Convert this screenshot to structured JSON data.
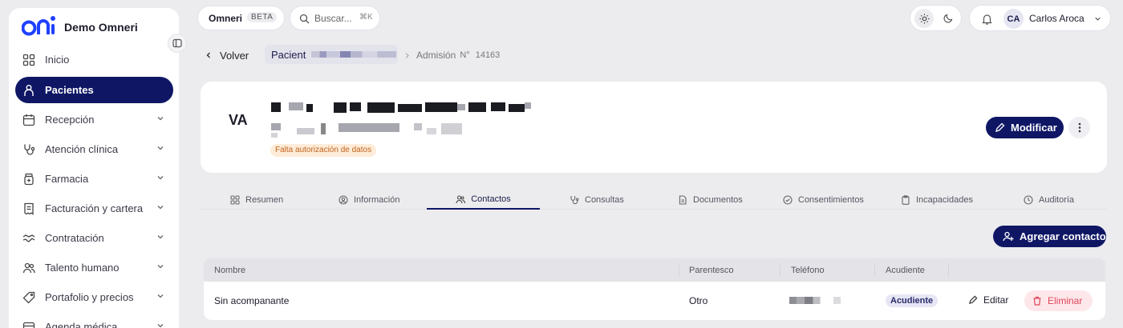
{
  "app": {
    "name": "Demo Omneri"
  },
  "sidebar": {
    "items": [
      {
        "label": "Inicio"
      },
      {
        "label": "Pacientes"
      },
      {
        "label": "Recepción"
      },
      {
        "label": "Atención clínica"
      },
      {
        "label": "Farmacia"
      },
      {
        "label": "Facturación y cartera"
      },
      {
        "label": "Contratación"
      },
      {
        "label": "Talento humano"
      },
      {
        "label": "Portafolio y precios"
      },
      {
        "label": "Agenda médica"
      }
    ]
  },
  "topbar": {
    "org": "Omneri",
    "beta": "BETA",
    "search_placeholder": "Buscar...",
    "search_shortcut": "⌘K",
    "user_initials": "CA",
    "user_name": "Carlos Aroca"
  },
  "breadcrumb": {
    "back": "Volver",
    "patient_label": "Pacient",
    "admission_label": "Admisión",
    "admission_prefix": "N°",
    "admission_number": "14163"
  },
  "patient": {
    "initials": "VA",
    "badge": "Falta autorización de datos",
    "modify_label": "Modificar"
  },
  "tabs": [
    {
      "label": "Resumen"
    },
    {
      "label": "Información"
    },
    {
      "label": "Contactos",
      "active": true
    },
    {
      "label": "Consultas"
    },
    {
      "label": "Documentos"
    },
    {
      "label": "Consentimientos"
    },
    {
      "label": "Incapacidades"
    },
    {
      "label": "Auditoría"
    }
  ],
  "contacts": {
    "add_label": "Agregar contacto",
    "columns": [
      "Nombre",
      "Parentesco",
      "Teléfono",
      "Acudiente"
    ],
    "rows": [
      {
        "name": "Sin acompanante",
        "relation": "Otro",
        "guardian": "Acudiente",
        "edit_label": "Editar",
        "delete_label": "Eliminar"
      }
    ]
  },
  "colors": {
    "primary": "#0f1765",
    "accent": "#1e40ff",
    "danger": "#e0455a",
    "warning_bg": "#fdecd9",
    "warning_text": "#c4621b"
  }
}
